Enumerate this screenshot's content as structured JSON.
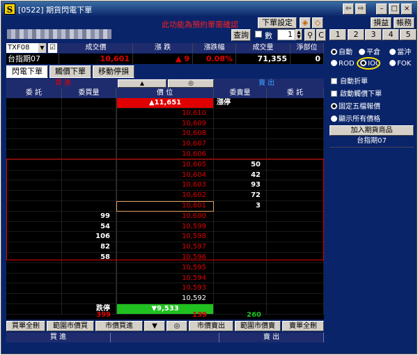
{
  "window": {
    "title": "[0522] 期貨閃電下單",
    "app_icon": "S",
    "controls": [
      "⇦",
      "⇨",
      "–",
      "□",
      "×"
    ]
  },
  "toolbar": {
    "warning": "此功能為預約單需確認",
    "order_settings": "下單設定",
    "nav_buttons": [
      "損益",
      "帳務"
    ],
    "query": "查詢",
    "qty_label": "數",
    "qty_value": "1",
    "pages": [
      "1",
      "2",
      "3",
      "4",
      "5"
    ],
    "c_button": "C"
  },
  "quote_header": {
    "symbol_code": "TXF08",
    "symbol_name": "台指期07",
    "headers": [
      "成交價",
      "漲 跌",
      "漲跌幅",
      "成交量",
      "淨部位"
    ],
    "values": [
      "10,601",
      "▲ 9",
      "0.08%",
      "71,355",
      "0"
    ]
  },
  "tabs": [
    "閃電下單",
    "觸價下單",
    "移動停損"
  ],
  "ladder": {
    "top_labels": {
      "buy": "買 進",
      "sell": "賣 出"
    },
    "top_buttons": [
      "▲",
      "◎"
    ],
    "columns": [
      "委 託",
      "委買量",
      "價 位",
      "委賣量",
      "委 託"
    ],
    "rows": [
      {
        "bid": "",
        "price": "▲11,651",
        "ask": "漲停",
        "kind": "limit-up"
      },
      {
        "bid": "",
        "price": "10,610",
        "ask": ""
      },
      {
        "bid": "",
        "price": "10,609",
        "ask": ""
      },
      {
        "bid": "",
        "price": "10,608",
        "ask": ""
      },
      {
        "bid": "",
        "price": "10,607",
        "ask": ""
      },
      {
        "bid": "",
        "price": "10,606",
        "ask": ""
      },
      {
        "bid": "",
        "price": "10,605",
        "ask": "50"
      },
      {
        "bid": "",
        "price": "10,604",
        "ask": "42"
      },
      {
        "bid": "",
        "price": "10,603",
        "ask": "93"
      },
      {
        "bid": "",
        "price": "10,602",
        "ask": "72"
      },
      {
        "bid": "",
        "price": "10,601",
        "ask": "3",
        "kind": "last"
      },
      {
        "bid": "99",
        "price": "10,600",
        "ask": ""
      },
      {
        "bid": "54",
        "price": "10,599",
        "ask": ""
      },
      {
        "bid": "106",
        "price": "10,598",
        "ask": ""
      },
      {
        "bid": "82",
        "price": "10,597",
        "ask": ""
      },
      {
        "bid": "58",
        "price": "10,596",
        "ask": ""
      },
      {
        "bid": "",
        "price": "10,595",
        "ask": ""
      },
      {
        "bid": "",
        "price": "10,594",
        "ask": ""
      },
      {
        "bid": "",
        "price": "10,593",
        "ask": ""
      },
      {
        "bid": "",
        "price": "10,592",
        "ask": "",
        "kind": "white"
      },
      {
        "bid": "跌停",
        "price": "▼9,533",
        "ask": "",
        "kind": "limit-down"
      }
    ],
    "totals": {
      "bid_total": "399",
      "mid": "139",
      "ask_total": "260"
    }
  },
  "bottom_buttons": [
    "買單全刪",
    "範圍市價買",
    "市價買進",
    "▼",
    "◎",
    "市價賣出",
    "範圍市價賣",
    "賣單全刪"
  ],
  "footer": {
    "buy": "買 進",
    "sell": "賣 出"
  },
  "right_panel": {
    "radios_row1": [
      "自動",
      "平倉",
      "當沖"
    ],
    "radios_row2": [
      "ROD",
      "IOC",
      "FOK"
    ],
    "checkboxes": [
      "自動折單",
      "啟動觸價下單"
    ],
    "radios_display": [
      "固定五檔報價",
      "顯示所有價格"
    ],
    "add_button": "加入期貨商品",
    "product_item": "台指期07"
  },
  "colors": {
    "up": "#e00000",
    "down": "#20c020",
    "panel": "#0a246a",
    "header": "#1e2c6e",
    "ring": "#ffe600"
  }
}
